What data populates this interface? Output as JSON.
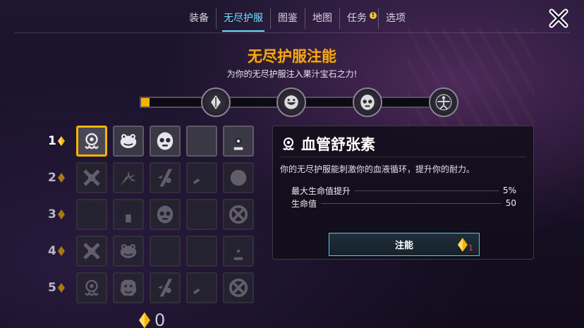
{
  "nav": {
    "tabs": [
      {
        "label": "装备",
        "active": false
      },
      {
        "label": "无尽护服",
        "active": true
      },
      {
        "label": "图鉴",
        "active": false
      },
      {
        "label": "地图",
        "active": false
      },
      {
        "label": "任务",
        "active": false,
        "alert": "!"
      },
      {
        "label": "选项",
        "active": false
      }
    ],
    "close_icon": "close-x-icon"
  },
  "header": {
    "title": "无尽护服注能",
    "subtitle": "为你的无尽护服注入果汁宝石之力!"
  },
  "progress": {
    "fill_fraction": 0.03,
    "milestones": [
      "crystal-icon",
      "grin-face-icon",
      "skull-mask-icon",
      "vitruvian-icon"
    ]
  },
  "grid": {
    "rows": [
      {
        "label": "1",
        "active": true,
        "slots": [
          "tentacle-face-icon",
          "frog-face-icon",
          "round-mask-icon",
          "fleur-mask-icon",
          "helmet-face-icon"
        ]
      },
      {
        "label": "2",
        "active": false,
        "slots": [
          "crossed-cross-icon",
          "shard-burst-icon",
          "slash-mark-icon",
          "swirl-icon",
          "spiral-skull-icon"
        ]
      },
      {
        "label": "3",
        "active": false,
        "slots": [
          "fleur-icon",
          "mushroom-icon",
          "round-mask-icon",
          "fleur-mask-icon",
          "target-cross-icon"
        ]
      },
      {
        "label": "4",
        "active": false,
        "slots": [
          "crossed-cross-icon",
          "frog-face-icon",
          "tri-swirl-icon",
          "flame-face-icon",
          "helmet-face-icon"
        ]
      },
      {
        "label": "5",
        "active": false,
        "slots": [
          "tentacle-face-icon",
          "bulldog-icon",
          "slash-mark-icon",
          "swirl-icon",
          "target-cross-icon"
        ]
      }
    ],
    "selected": {
      "row": 0,
      "col": 0
    }
  },
  "currency": {
    "icon": "juice-gem-icon",
    "amount": "0"
  },
  "detail": {
    "icon": "tentacle-face-icon",
    "title": "血管舒张素",
    "description": "你的无尽护服能刺激你的血液循环，提升你的耐力。",
    "stats": [
      {
        "name": "最大生命值提升",
        "value": "5%"
      },
      {
        "name": "生命值",
        "value": "50"
      }
    ],
    "button": {
      "label": "注能",
      "cost": "1",
      "cost_icon": "juice-gem-icon"
    }
  },
  "colors": {
    "accent_gold": "#f5b400",
    "accent_cyan": "#6ee0ff",
    "title_orange": "#f7a81e",
    "cost_red": "#ff3b3b"
  }
}
